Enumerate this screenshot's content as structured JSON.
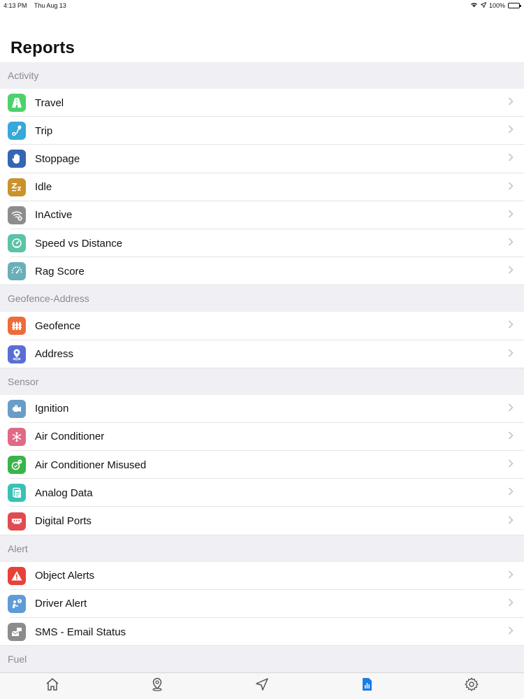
{
  "status_bar": {
    "time": "4:13 PM",
    "date": "Thu Aug 13",
    "battery": "100%"
  },
  "page_title": "Reports",
  "sections": [
    {
      "header": "Activity",
      "items": [
        {
          "label": "Travel",
          "icon": "road-icon",
          "color": "#4cd16b"
        },
        {
          "label": "Trip",
          "icon": "route-icon",
          "color": "#37a8d9"
        },
        {
          "label": "Stoppage",
          "icon": "hand-stop-icon",
          "color": "#3565b5"
        },
        {
          "label": "Idle",
          "icon": "sleep-zz-icon",
          "color": "#c9922c"
        },
        {
          "label": "InActive",
          "icon": "wifi-off-icon",
          "color": "#8d8d8d"
        },
        {
          "label": "Speed vs Distance",
          "icon": "speed-icon",
          "color": "#5ac3a8"
        },
        {
          "label": "Rag Score",
          "icon": "gauge-icon",
          "color": "#6aaeb8"
        }
      ]
    },
    {
      "header": "Geofence-Address",
      "items": [
        {
          "label": "Geofence",
          "icon": "fence-icon",
          "color": "#ef6b3a"
        },
        {
          "label": "Address",
          "icon": "location-pin-icon",
          "color": "#5a6fd6"
        }
      ]
    },
    {
      "header": "Sensor",
      "items": [
        {
          "label": "Ignition",
          "icon": "engine-icon",
          "color": "#6b9cc7"
        },
        {
          "label": "Air Conditioner",
          "icon": "snowflake-icon",
          "color": "#e06a86"
        },
        {
          "label": "Air Conditioner Misused",
          "icon": "ac-misuse-icon",
          "color": "#3ab34a"
        },
        {
          "label": "Analog Data",
          "icon": "analog-data-icon",
          "color": "#38c2b6"
        },
        {
          "label": "Digital Ports",
          "icon": "port-icon",
          "color": "#e04b52"
        }
      ]
    },
    {
      "header": "Alert",
      "items": [
        {
          "label": "Object Alerts",
          "icon": "warning-icon",
          "color": "#e8413a"
        },
        {
          "label": "Driver Alert",
          "icon": "driver-alert-icon",
          "color": "#5f9bd6"
        },
        {
          "label": "SMS - Email Status",
          "icon": "sms-email-icon",
          "color": "#8c8c8c"
        }
      ]
    },
    {
      "header": "Fuel",
      "items": []
    }
  ],
  "tab_bar": [
    {
      "name": "home",
      "icon": "home-icon",
      "active": false
    },
    {
      "name": "map",
      "icon": "map-pin-icon",
      "active": false
    },
    {
      "name": "navigate",
      "icon": "navigation-arrow-icon",
      "active": false
    },
    {
      "name": "reports",
      "icon": "reports-icon",
      "active": true
    },
    {
      "name": "settings",
      "icon": "gear-icon",
      "active": false
    }
  ],
  "colors": {
    "accent": "#1a7ce6",
    "inactive_tab": "#555555",
    "section_bg": "#efeff4",
    "section_text": "#8a8a8f"
  }
}
